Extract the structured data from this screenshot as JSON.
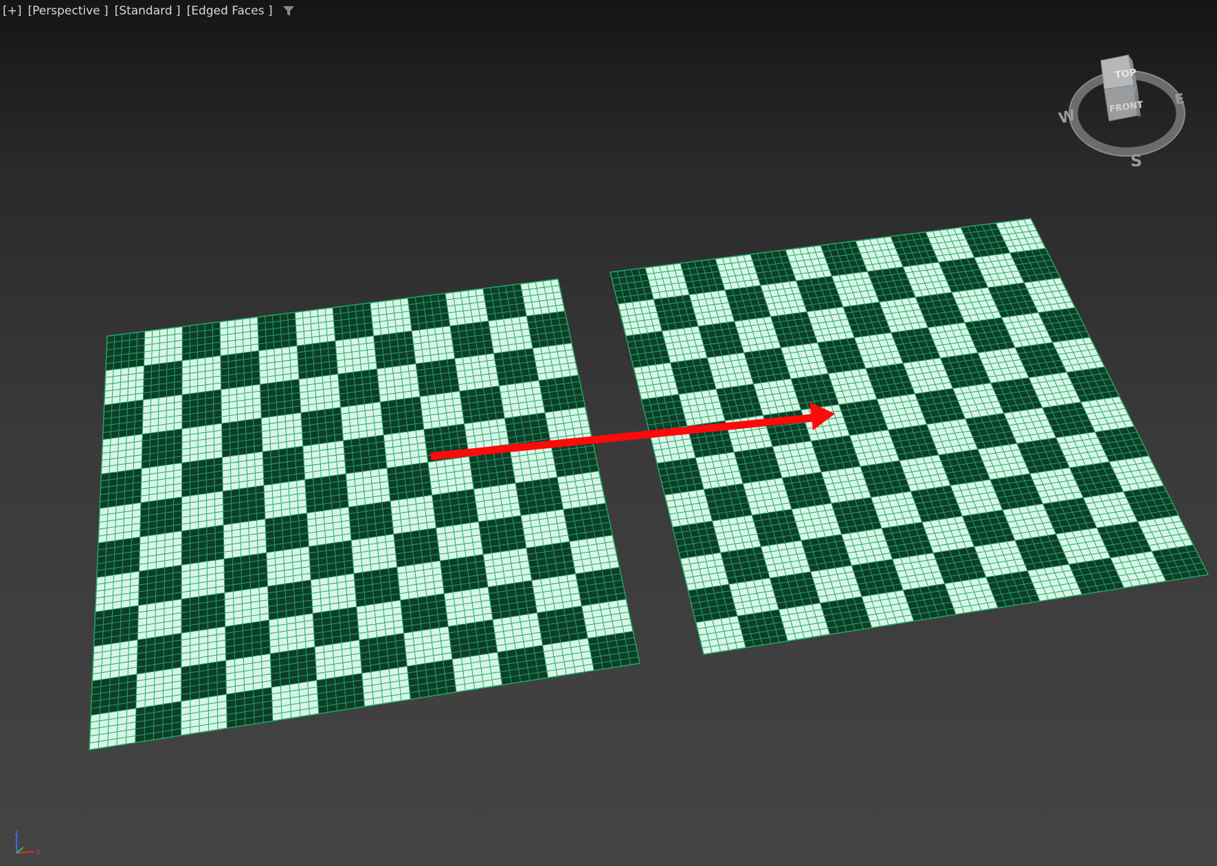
{
  "viewport": {
    "labels": {
      "plus": "[+]",
      "view": "[Perspective ]",
      "shading": "[Standard ]",
      "edges": "[Edged Faces ]"
    },
    "filter_icon": "funnel-filter-icon",
    "background_top": "#151515",
    "background_bottom": "#444444"
  },
  "viewcube": {
    "top_face": "TOP",
    "front_face": "FRONT",
    "compass": {
      "west": "W",
      "east": "E",
      "south": "S"
    }
  },
  "axis_tripod": {
    "z": "z",
    "x": "x",
    "z_color": "#3a6bff",
    "x_color": "#e03030"
  },
  "planes": [
    {
      "name": "left-checker-plane",
      "checker_squares": 12,
      "subdivisions_per_square": 5
    },
    {
      "name": "right-checker-plane",
      "checker_squares": 12,
      "subdivisions_per_square": 5
    }
  ],
  "colors": {
    "checker_light": "#d9f5e8",
    "checker_dark": "#0e3d2a",
    "wire": "#1fa862",
    "arrow": "#ff0a0a"
  }
}
